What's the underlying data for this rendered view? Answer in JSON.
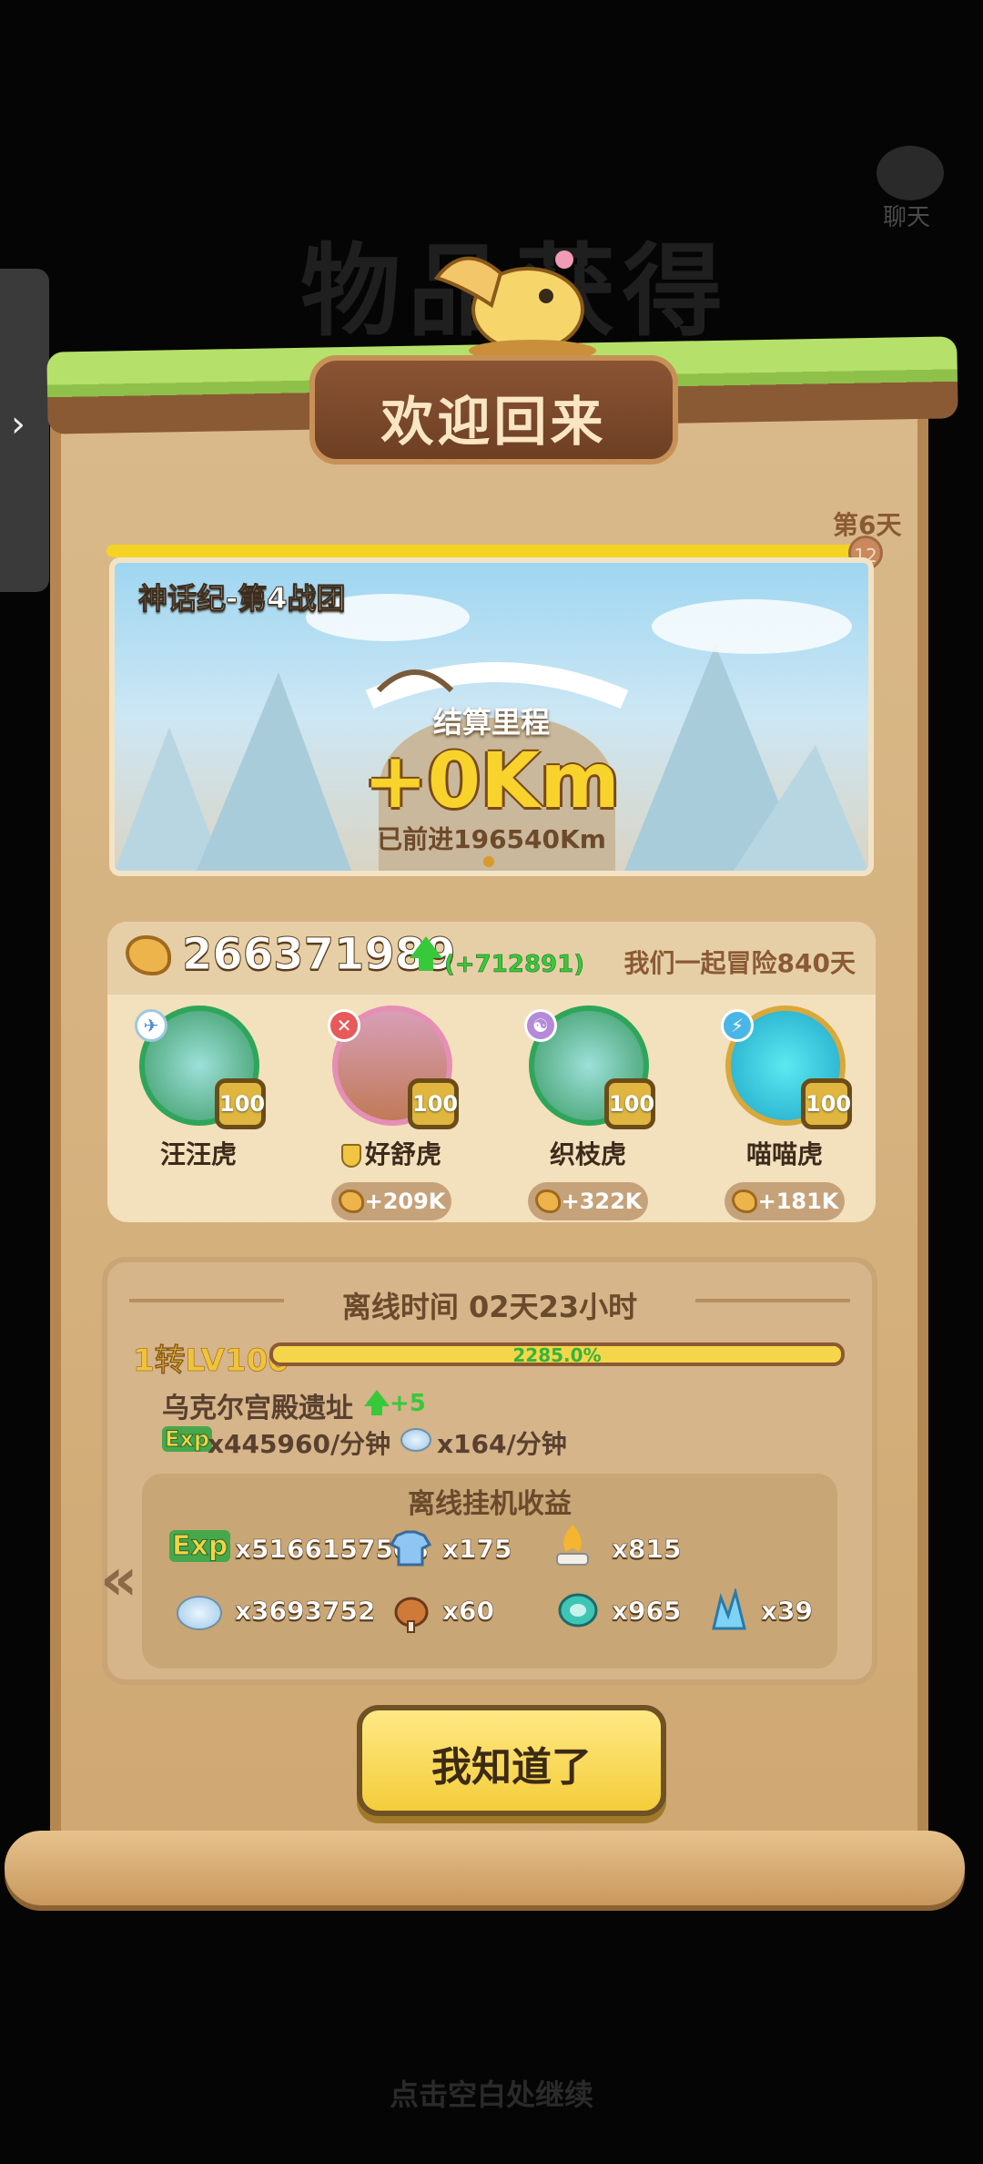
{
  "background_title": "物品获得",
  "chat": {
    "label": "聊天"
  },
  "header": {
    "title": "欢迎回来"
  },
  "banner": {
    "day_label": "第6天",
    "day_badge": "12",
    "team": "神话纪-第4战团",
    "subtitle": "结算里程",
    "km_gain": "+0Km",
    "progress": "已前进196540Km"
  },
  "coins": {
    "total": "266371989",
    "gain": "(+712891)",
    "adventure_days": "我们一起冒险840天"
  },
  "heroes": [
    {
      "name": "汪汪虎",
      "level": "100",
      "element": "✈"
    },
    {
      "name": "好舒虎",
      "level": "100",
      "element": "✕",
      "bonus": "+209K"
    },
    {
      "name": "织枝虎",
      "level": "100",
      "element": "☯",
      "bonus": "+322K"
    },
    {
      "name": "喵喵虎",
      "level": "100",
      "element": "⚡",
      "bonus": "+181K"
    }
  ],
  "offline": {
    "time": "离线时间 02天23小时",
    "level_label": "1转LV100",
    "level_progress_text": "2285.0%",
    "level_progress": 1.0,
    "map_name": "乌克尔宫殿遗址",
    "map_bonus": "+5",
    "exp_icon": "Exp",
    "exp_rate": "x445960/分钟",
    "stone_rate": "x164/分钟"
  },
  "rewards": {
    "title": "离线挂机收益",
    "exp_icon": "Exp",
    "items": [
      {
        "icon": "exp-icon",
        "value": "x5166157508"
      },
      {
        "icon": "shirt-icon",
        "value": "x175"
      },
      {
        "icon": "fire-icon",
        "value": "x815"
      },
      {
        "icon": "stone-icon",
        "value": "x3693752"
      },
      {
        "icon": "meat-icon",
        "value": "x60"
      },
      {
        "icon": "gem-icon",
        "value": "x965"
      },
      {
        "icon": "crystal-icon",
        "value": "x39"
      }
    ]
  },
  "ok_button": "我知道了",
  "continue_hint": "点击空白处继续",
  "colors": {
    "accent_yellow": "#f5d322",
    "gain_green": "#38c93a",
    "parchment": "#d4b07c"
  }
}
